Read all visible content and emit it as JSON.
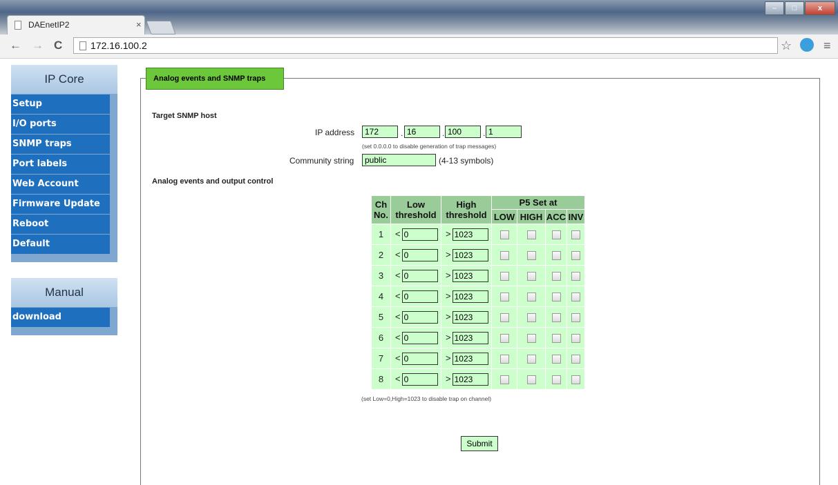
{
  "browser": {
    "tab_title": "DAEnetIP2",
    "tab_close": "×",
    "url": "172.16.100.2",
    "nav_back": "←",
    "nav_forward": "→",
    "nav_reload": "C",
    "star": "☆",
    "menu": "≡",
    "win_minimize": "–",
    "win_maximize": "□",
    "win_close": "x"
  },
  "sidebar": {
    "core_title": "IP Core",
    "core_items": [
      "Setup",
      "I/O ports",
      "SNMP traps",
      "Port labels",
      "Web Account",
      "Firmware Update",
      "Reboot",
      "Default"
    ],
    "manual_title": "Manual",
    "manual_items": [
      "download"
    ],
    "item_color": "#1f6fbf"
  },
  "panel": {
    "tab_label": "Analog events and SNMP traps",
    "tab_color": "#6cc83a",
    "target_heading": "Target SNMP host",
    "ip_label": "IP address",
    "ip": [
      "172",
      "16",
      "100",
      "1"
    ],
    "ip_dot": ".",
    "ip_hint": "(set 0.0.0.0 to disable generation of trap messages)",
    "community_label": "Community string",
    "community_value": "public",
    "community_hint": "(4-13 symbols)",
    "events_heading": "Analog events and output control",
    "table": {
      "headers": {
        "ch": "Ch No.",
        "low": "Low threshold",
        "high": "High threshold",
        "p5": "P5 Set at",
        "low_cb": "LOW",
        "high_cb": "HIGH",
        "acc": "ACC",
        "inv": "INV"
      },
      "lt": "<",
      "gt": ">",
      "rows": [
        {
          "ch": "1",
          "low": "0",
          "high": "1023"
        },
        {
          "ch": "2",
          "low": "0",
          "high": "1023"
        },
        {
          "ch": "3",
          "low": "0",
          "high": "1023"
        },
        {
          "ch": "4",
          "low": "0",
          "high": "1023"
        },
        {
          "ch": "5",
          "low": "0",
          "high": "1023"
        },
        {
          "ch": "6",
          "low": "0",
          "high": "1023"
        },
        {
          "ch": "7",
          "low": "0",
          "high": "1023"
        },
        {
          "ch": "8",
          "low": "0",
          "high": "1023"
        }
      ]
    },
    "table_hint": "(set Low=0,High=1023 to disable trap on channel)",
    "submit_label": "Submit",
    "field_color": "#ccffcc",
    "header_color": "#99cc99"
  }
}
